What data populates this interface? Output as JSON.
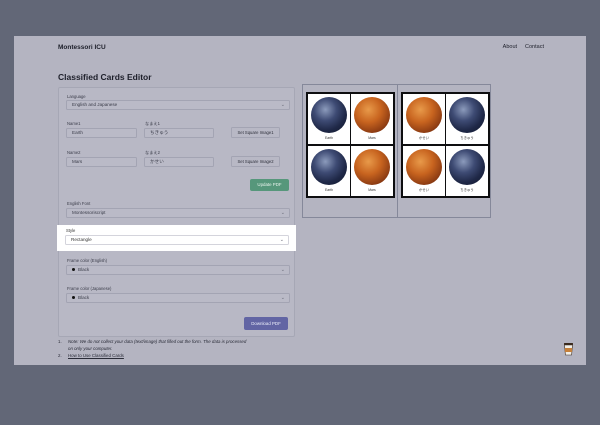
{
  "header": {
    "brand": "Montessori ICU",
    "nav": [
      "About",
      "Contact"
    ]
  },
  "page_title": "Classified Cards Editor",
  "form": {
    "language": {
      "label": "Language",
      "value": "English and Japanese"
    },
    "name1": {
      "label": "Name1",
      "value": "Earth",
      "jp_label": "なまえ1",
      "jp_value": "ちきゅう",
      "image_button": "Set Square Image1"
    },
    "name2": {
      "label": "Name2",
      "value": "Mars",
      "jp_label": "なまえ2",
      "jp_value": "かせい",
      "image_button": "Set Square Image2"
    },
    "update_button": "Update PDF",
    "english_font": {
      "label": "English Font",
      "value": "Montessoriscript"
    },
    "style": {
      "label": "Style",
      "value": "Rectangle"
    },
    "frame_en": {
      "label": "Frame color (English)",
      "value": "Black"
    },
    "frame_jp": {
      "label": "Frame color (Japanese)",
      "value": "Black"
    },
    "download_button": "Download PDF"
  },
  "notes": [
    "Note: We do not collect your data (text/image) that filled out the form. The data is processed",
    "on only your computer.",
    "How to Use Classified Cards"
  ],
  "preview": {
    "cards_en": [
      {
        "image": "earth",
        "caption": "Earth"
      },
      {
        "image": "mars",
        "caption": "Mars"
      },
      {
        "image": "earth",
        "caption": "Earth"
      },
      {
        "image": "mars",
        "caption": "Mars"
      }
    ],
    "cards_jp": [
      {
        "image": "mars",
        "caption": "かせい"
      },
      {
        "image": "earth",
        "caption": "ちきゅう"
      },
      {
        "image": "mars",
        "caption": "かせい"
      },
      {
        "image": "earth",
        "caption": "ちきゅう"
      }
    ]
  },
  "colors": {
    "overlay": "#626777",
    "green": "#56977b",
    "purple": "#6265a4",
    "highlight": "#ffffff"
  },
  "icons": {
    "coffee": "coffee-cup-icon",
    "chevron": "chevron-down-icon"
  }
}
